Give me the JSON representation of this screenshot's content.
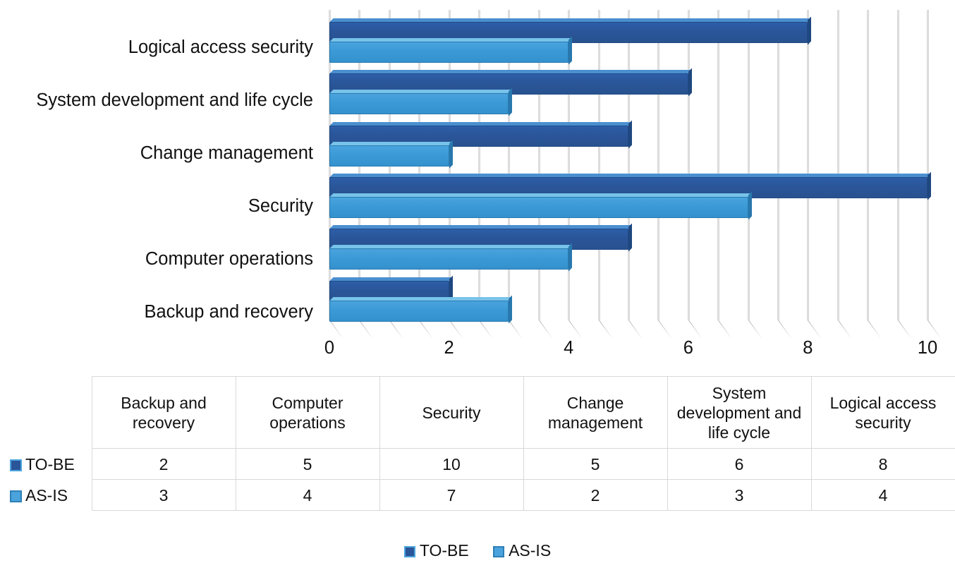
{
  "chart_data": {
    "type": "bar",
    "orientation": "horizontal",
    "title": "",
    "xlabel": "",
    "ylabel": "",
    "xlim": [
      0,
      10
    ],
    "xticks": [
      "0",
      "2",
      "4",
      "6",
      "8",
      "10"
    ],
    "grid": true,
    "grid_step": 0.5,
    "legend_position": "bottom",
    "categories": [
      "Backup and recovery",
      "Computer operations",
      "Security",
      "Change management",
      "System development and life cycle",
      "Logical access security"
    ],
    "series": [
      {
        "name": "TO-BE",
        "color": "#2a5599",
        "values": [
          2,
          5,
          10,
          5,
          6,
          8
        ]
      },
      {
        "name": "AS-IS",
        "color": "#4aa3dd",
        "values": [
          3,
          4,
          7,
          2,
          3,
          4
        ]
      }
    ]
  },
  "chart": {
    "category_labels_top_to_bottom": [
      "Logical access security",
      "System development and life cycle",
      "Change management",
      "Security",
      "Computer operations",
      "Backup and recovery"
    ],
    "axis_ticks": [
      "0",
      "2",
      "4",
      "6",
      "8",
      "10"
    ]
  },
  "table": {
    "corner_label": "",
    "column_headers": [
      "Backup and recovery",
      "Computer operations",
      "Security",
      "Change management",
      "System development and life cycle",
      "Logical access security"
    ],
    "rows": [
      {
        "label": "TO-BE",
        "swatch": "tobe-swatch-icon",
        "values": [
          "2",
          "5",
          "10",
          "5",
          "6",
          "8"
        ]
      },
      {
        "label": "AS-IS",
        "swatch": "asis-swatch-icon",
        "values": [
          "3",
          "4",
          "7",
          "2",
          "3",
          "4"
        ]
      }
    ]
  },
  "legend": {
    "items": [
      {
        "label": "TO-BE",
        "color": "#2a5599"
      },
      {
        "label": "AS-IS",
        "color": "#4aa3dd"
      }
    ]
  },
  "colors": {
    "to_be": "#2a5599",
    "as_is": "#4aa3dd",
    "gridline": "#d9d9d9",
    "text": "#111111",
    "background": "#ffffff"
  }
}
